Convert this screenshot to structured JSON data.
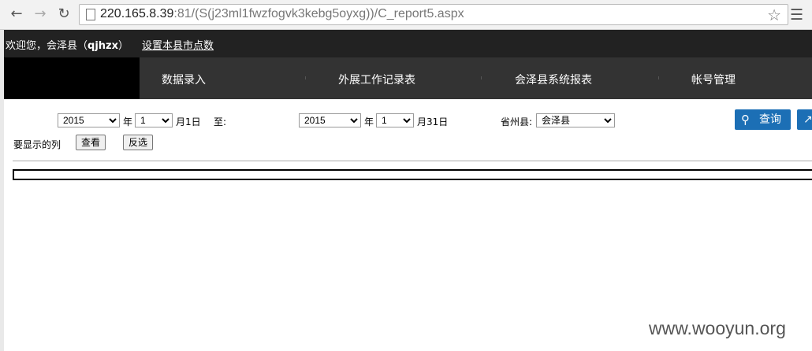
{
  "browser": {
    "url_host": "220.165.8.39",
    "url_rest": ":81/(S(j23ml1fwzfogvk3kebg5oyxg))/C_report5.aspx"
  },
  "header": {
    "welcome_prefix": "欢迎您，会泽县（",
    "username": "qjhzx",
    "welcome_suffix": "）",
    "settings_link": "设置本县市点数"
  },
  "nav": {
    "items": [
      {
        "label": "数据录入"
      },
      {
        "label": "外展工作记录表"
      },
      {
        "label": "会泽县系统报表"
      },
      {
        "label": "帐号管理"
      }
    ]
  },
  "form": {
    "start_year": "2015",
    "start_month": "1",
    "year_label": "年",
    "start_day_label": "月1日",
    "to_label": "至:",
    "end_year": "2015",
    "end_month": "1",
    "end_day_label": "月31日",
    "region_label": "省州县:",
    "region_value": "会泽县",
    "columns_label": "要显示的列",
    "view_button": "查看",
    "invert_button": "反选",
    "query_button": "查询"
  },
  "watermark": "www.wooyun.org",
  "icons": {
    "back": "back-arrow-icon",
    "forward": "forward-arrow-icon",
    "reload": "reload-icon",
    "bookmark": "star-icon",
    "menu": "hamburger-menu-icon",
    "query": "search-icon",
    "export": "export-icon"
  },
  "colors": {
    "header_bg": "#222222",
    "nav_bg": "#333333",
    "button_blue": "#1c6fb5"
  }
}
